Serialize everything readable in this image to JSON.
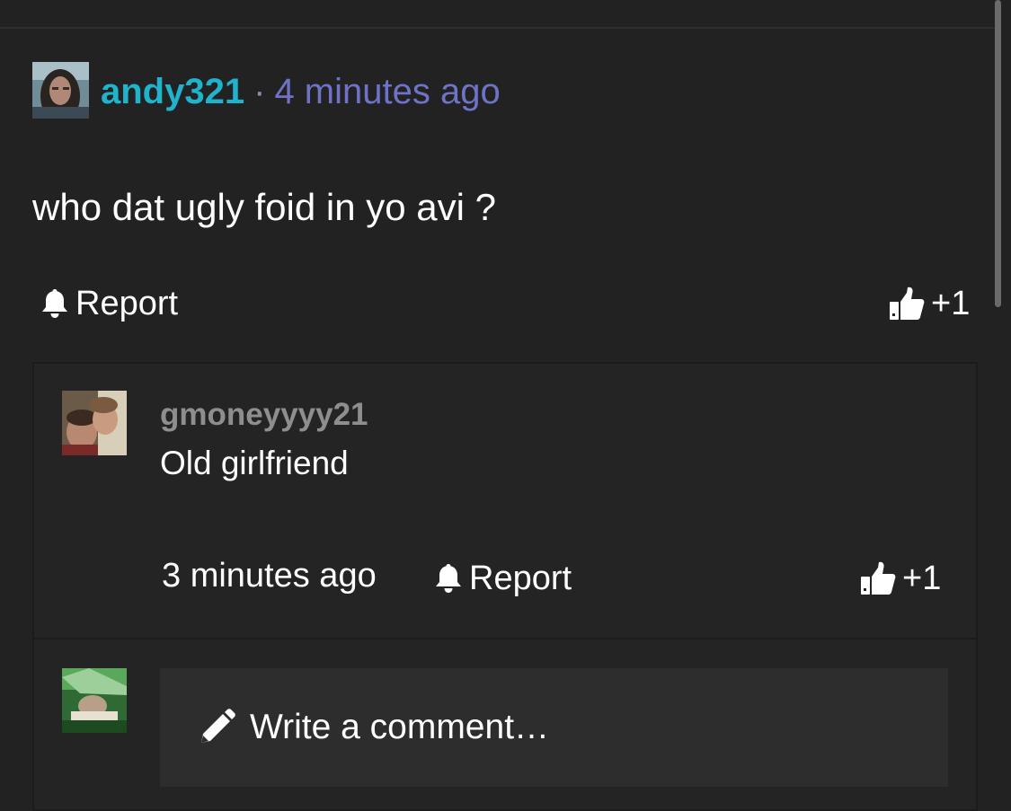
{
  "comment": {
    "username": "andy321",
    "separator": "·",
    "time": "4 minutes ago",
    "text": "who dat ugly foid in yo avi ?",
    "report_label": "Report",
    "like_label": "+1"
  },
  "reply": {
    "username": "gmoneyyyy21",
    "text": "Old girlfriend",
    "time": "3 minutes ago",
    "report_label": "Report",
    "like_label": "+1"
  },
  "composer": {
    "placeholder": "Write a comment…"
  },
  "colors": {
    "background": "#222222",
    "username_main": "#1fb3cc",
    "timestamp_main": "#6f73c8",
    "reply_username": "#8e8e8e",
    "text": "#ffffff"
  },
  "icons": {
    "report": "bell-icon",
    "like": "thumbs-up-icon",
    "compose": "pencil-icon"
  }
}
